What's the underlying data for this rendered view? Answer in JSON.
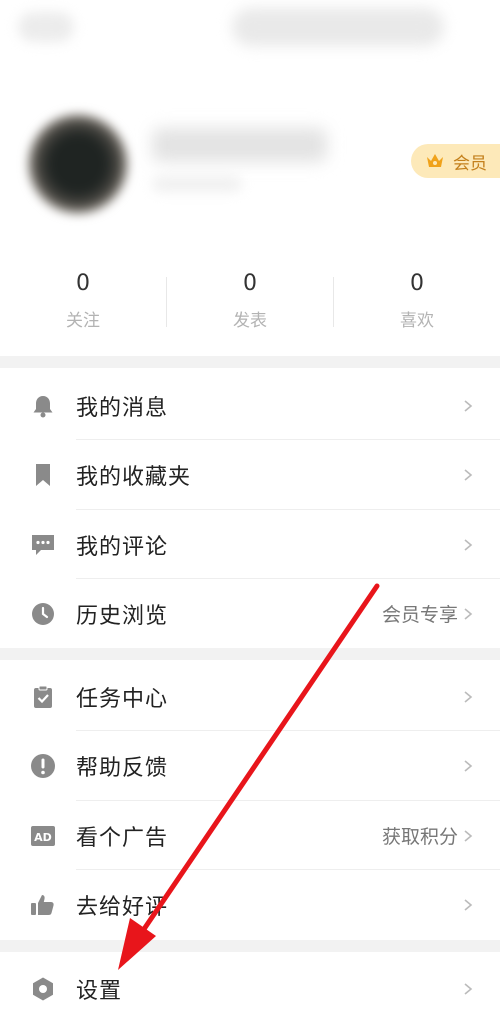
{
  "profile": {
    "vip_label": "会员",
    "stats": [
      {
        "count": "0",
        "label": "关注"
      },
      {
        "count": "0",
        "label": "发表"
      },
      {
        "count": "0",
        "label": "喜欢"
      }
    ]
  },
  "menu": {
    "group1": [
      {
        "label": "我的消息",
        "icon": "bell-icon"
      },
      {
        "label": "我的收藏夹",
        "icon": "bookmark-icon"
      },
      {
        "label": "我的评论",
        "icon": "comment-icon"
      },
      {
        "label": "历史浏览",
        "icon": "clock-icon",
        "extra": "会员专享"
      }
    ],
    "group2": [
      {
        "label": "任务中心",
        "icon": "task-clipboard-icon"
      },
      {
        "label": "帮助反馈",
        "icon": "exclamation-icon"
      },
      {
        "label": "看个广告",
        "icon": "ad-icon",
        "extra": "获取积分"
      },
      {
        "label": "去给好评",
        "icon": "thumbs-up-icon"
      }
    ],
    "group3": [
      {
        "label": "设置",
        "icon": "settings-hexagon-icon"
      }
    ]
  },
  "colors": {
    "icon_gray": "#8a8a8a",
    "vip_bg": "#fde9b9",
    "vip_text": "#c4801c",
    "annotation_arrow": "#e8151b",
    "section_gap": "#f2f2f2"
  }
}
